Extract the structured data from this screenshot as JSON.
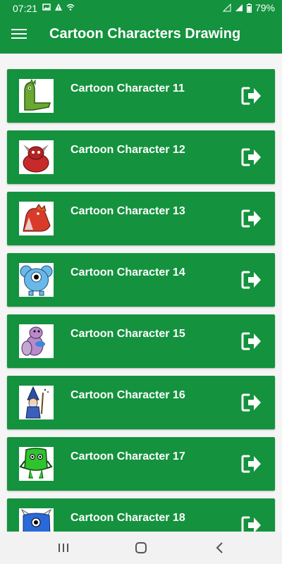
{
  "status_bar": {
    "time": "07:21",
    "battery": "79%",
    "icons": [
      "image-icon",
      "warning-icon",
      "wifi-icon",
      "signal-icon",
      "4g-icon",
      "battery-icon"
    ]
  },
  "app_bar": {
    "title": "Cartoon Characters Drawing",
    "menu_icon": "hamburger-menu-icon"
  },
  "colors": {
    "primary": "#14923e",
    "background": "#f5f5f5",
    "text_on_primary": "#ffffff"
  },
  "items": [
    {
      "label": "Cartoon Character 11",
      "thumb": "green-dinosaur",
      "action_icon": "open-arrow-icon"
    },
    {
      "label": "Cartoon Character 12",
      "thumb": "red-horned-monster",
      "action_icon": "open-arrow-icon"
    },
    {
      "label": "Cartoon Character 13",
      "thumb": "red-dragon",
      "action_icon": "open-arrow-icon"
    },
    {
      "label": "Cartoon Character 14",
      "thumb": "blue-one-eyed-monster",
      "action_icon": "open-arrow-icon"
    },
    {
      "label": "Cartoon Character 15",
      "thumb": "purple-beaver",
      "action_icon": "open-arrow-icon"
    },
    {
      "label": "Cartoon Character 16",
      "thumb": "blue-wizard",
      "action_icon": "open-arrow-icon"
    },
    {
      "label": "Cartoon Character 17",
      "thumb": "green-monster",
      "action_icon": "open-arrow-icon"
    },
    {
      "label": "Cartoon Character 18",
      "thumb": "blue-horned-monster",
      "action_icon": "open-arrow-icon"
    }
  ],
  "nav_bar": {
    "icons": [
      "recent-apps-icon",
      "home-icon",
      "back-icon"
    ]
  }
}
